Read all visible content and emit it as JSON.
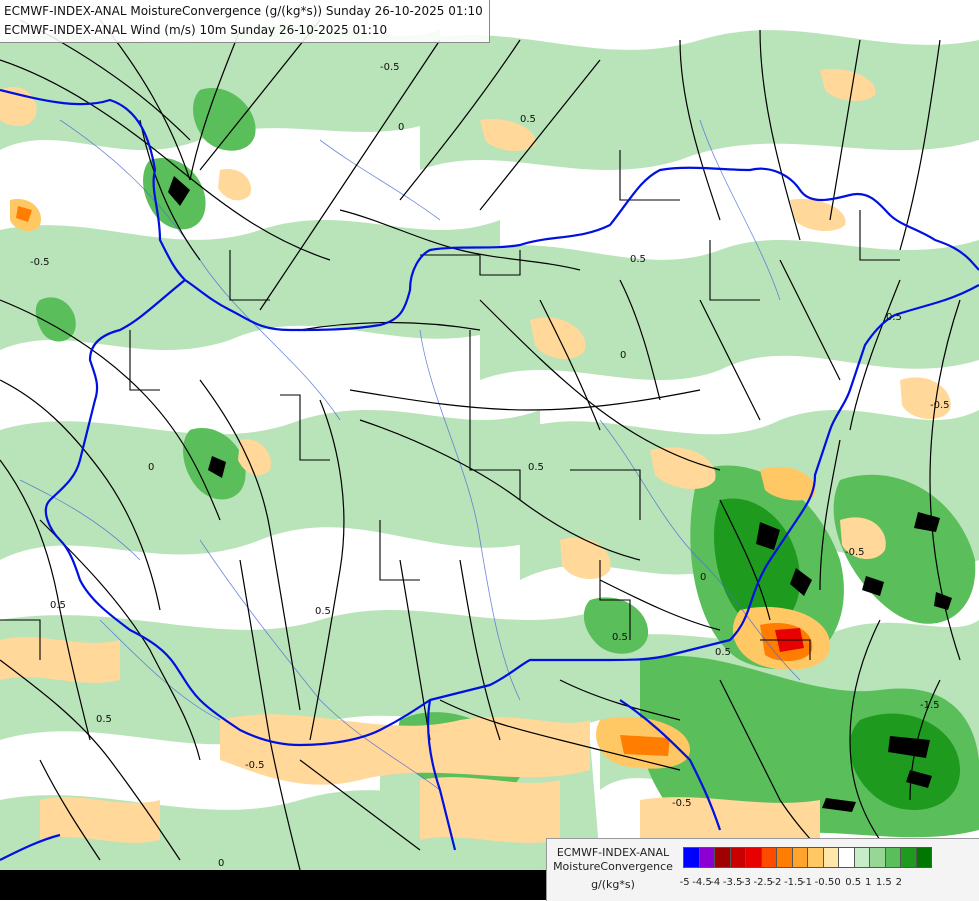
{
  "title": {
    "line1": "ECMWF-INDEX-ANAL MoistureConvergence (g/(kg*s)) Sunday 26-10-2025 01:10",
    "line2": "ECMWF-INDEX-ANAL Wind (m/s) 10m Sunday 26-10-2025 01:10"
  },
  "legend": {
    "line1": "ECMWF-INDEX-ANAL",
    "line2": "MoistureConvergence",
    "line3": "g/(kg*s)",
    "ticks": [
      "-5",
      "-4.5",
      "-4",
      "-3.5",
      "-3",
      "-2.5",
      "-2",
      "-1.5",
      "-1",
      "-0.5",
      "0",
      "0.5",
      "1",
      "1.5",
      "2"
    ],
    "colors": [
      "#0000ff",
      "#8c00d2",
      "#a00000",
      "#c80000",
      "#e60000",
      "#ff4b00",
      "#ff7d00",
      "#ffa52d",
      "#ffc864",
      "#ffe6aa",
      "#ffffff",
      "#c8ebc8",
      "#96d796",
      "#5abe5a",
      "#1e9b1e",
      "#007800"
    ]
  },
  "map": {
    "contour_labels": [
      "-0.5",
      "0",
      "0.5",
      "-0.5",
      "0",
      "0.5",
      "0.5",
      "0",
      "-0.5",
      "0.5",
      "0",
      "0.5",
      "0.5",
      "0.5",
      "-0.5",
      "-1.5",
      "-0.5",
      "0.5",
      "0",
      "-0.5",
      "0.5"
    ],
    "colors": {
      "country_border": "#0010e0",
      "rivers": "#4a6cd4",
      "admin_border": "#000000",
      "streamline": "#000000",
      "convergence_strong": "#1e9b1e",
      "convergence_weak": "#96d796",
      "divergence_weak": "#ffd89a",
      "divergence_strong": "#ff7d00"
    }
  }
}
